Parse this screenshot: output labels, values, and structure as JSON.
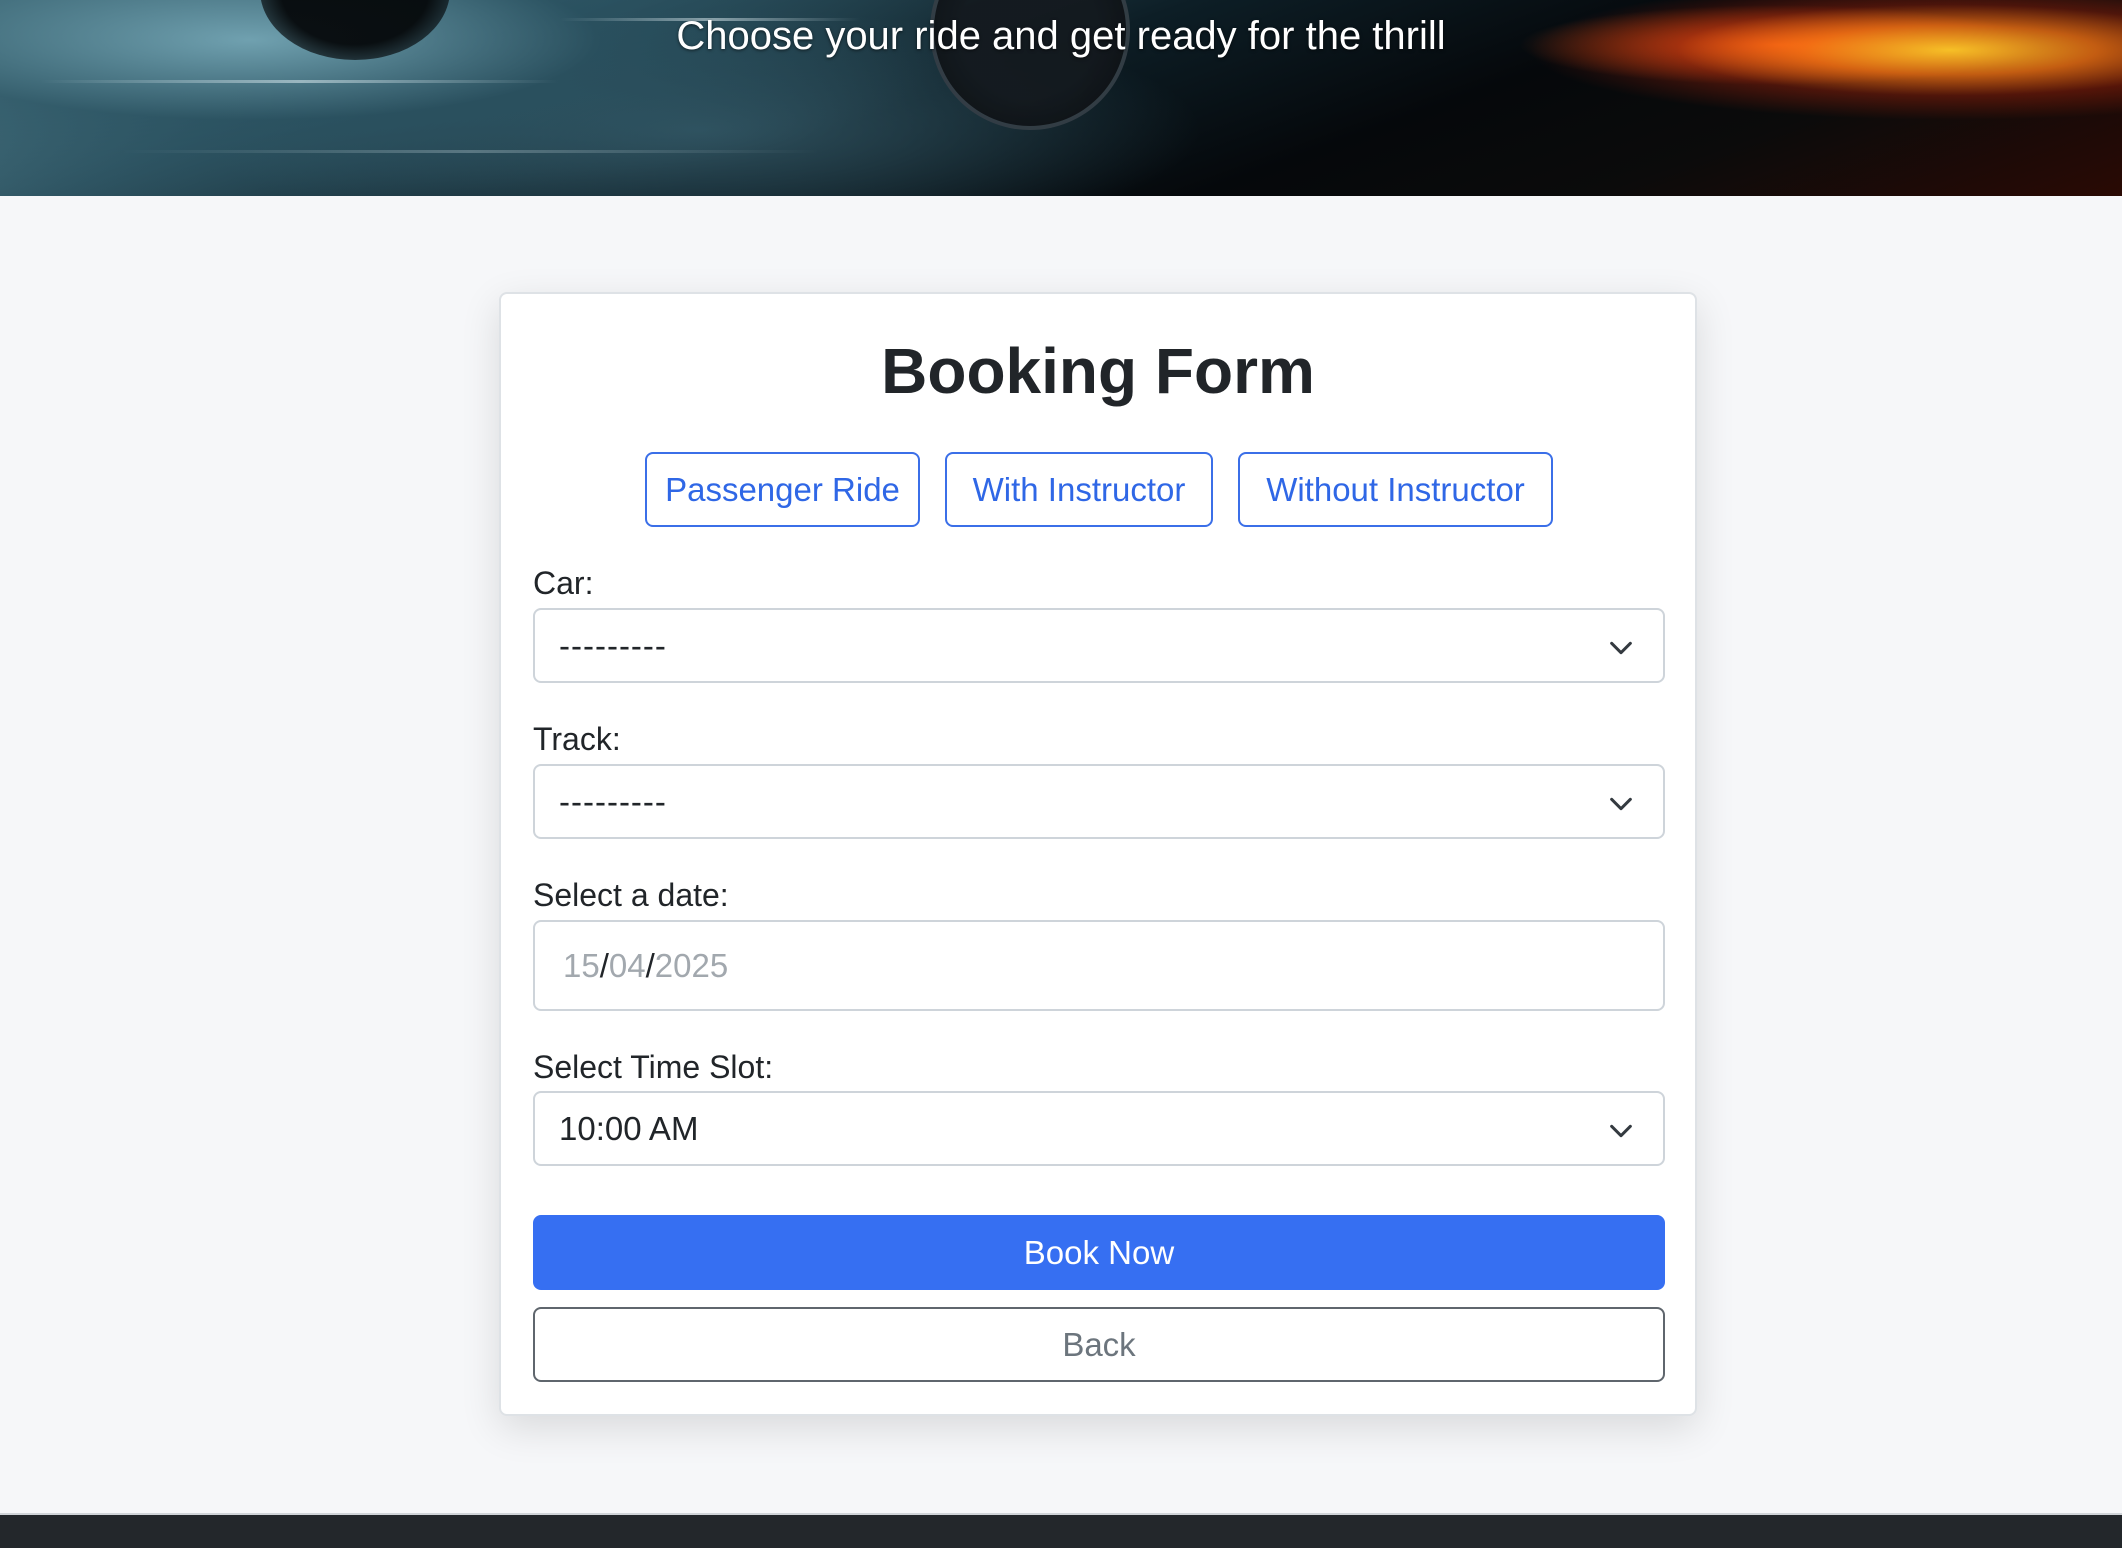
{
  "hero": {
    "subtitle": "Choose your ride and get ready for the thrill"
  },
  "form": {
    "title": "Booking Form",
    "ride_types": [
      {
        "label": "Passenger Ride"
      },
      {
        "label": "With Instructor"
      },
      {
        "label": "Without Instructor"
      }
    ],
    "car": {
      "label": "Car:",
      "value": "---------"
    },
    "track": {
      "label": "Track:",
      "value": "---------"
    },
    "date": {
      "label": "Select a date:",
      "day": "15",
      "month": "04",
      "year": "2025",
      "separator": "/"
    },
    "time_slot": {
      "label": "Select Time Slot:",
      "value": "10:00 AM"
    },
    "book_label": "Book Now",
    "back_label": "Back"
  },
  "colors": {
    "primary": "#366ff2",
    "outline_primary": "#3b6fe8",
    "footer": "#23272b"
  },
  "icons": {
    "dropdown": "chevron-down-icon"
  }
}
